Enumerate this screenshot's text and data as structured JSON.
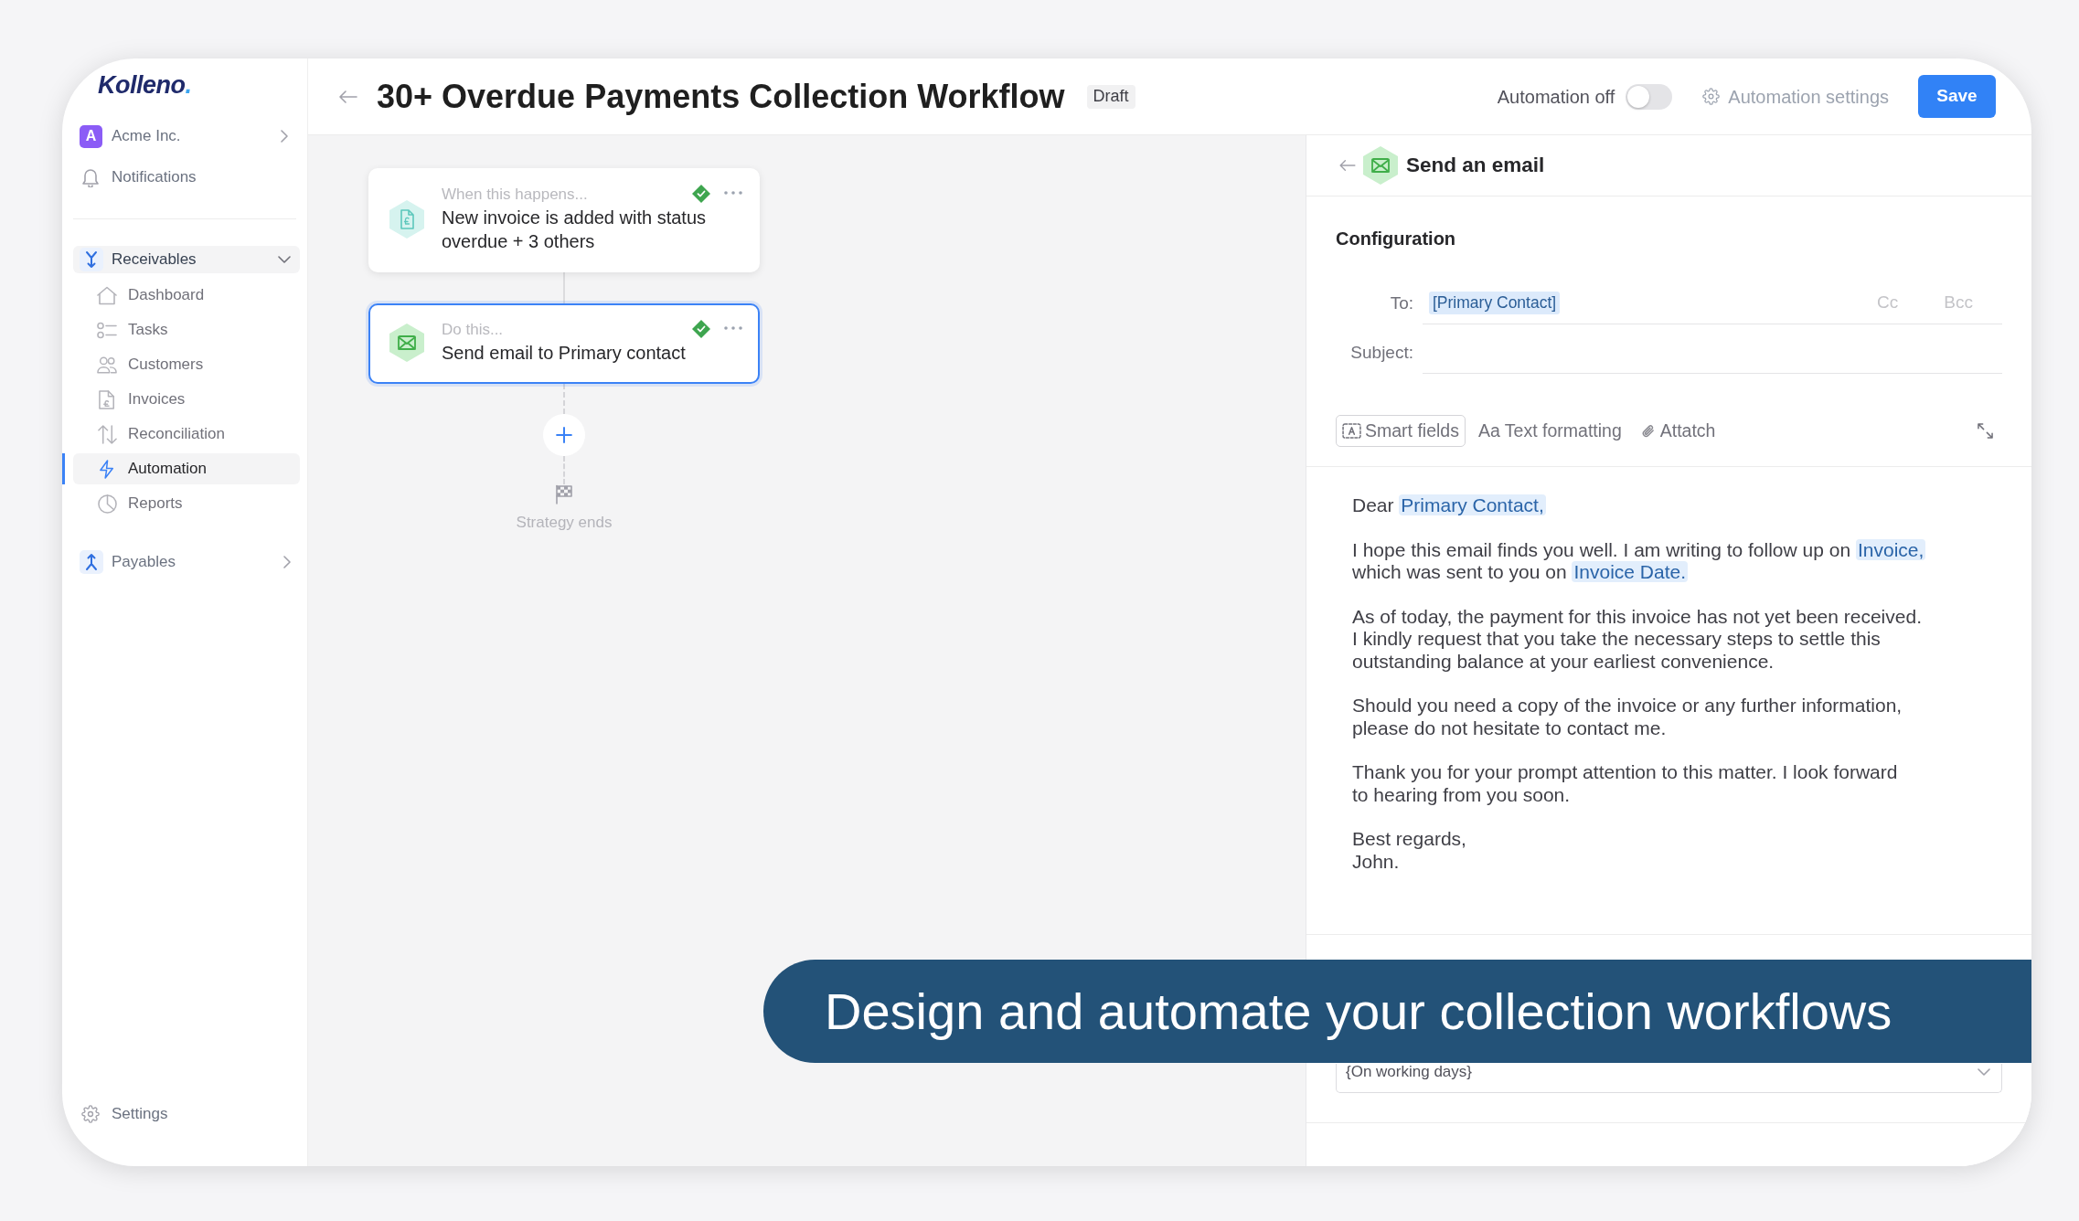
{
  "sidebar": {
    "logo": "Kolleno.",
    "workspace": {
      "initial": "A",
      "name": "Acme Inc."
    },
    "notifications": "Notifications",
    "sections": [
      {
        "label": "Receivables",
        "expanded": true,
        "children": [
          {
            "label": "Dashboard",
            "selected": false
          },
          {
            "label": "Tasks",
            "selected": false
          },
          {
            "label": "Customers",
            "selected": false
          },
          {
            "label": "Invoices",
            "selected": false
          },
          {
            "label": "Reconciliation",
            "selected": false
          },
          {
            "label": "Automation",
            "selected": true
          },
          {
            "label": "Reports",
            "selected": false
          }
        ]
      },
      {
        "label": "Payables",
        "expanded": false
      }
    ],
    "settings": "Settings"
  },
  "header": {
    "title": "30+ Overdue Payments Collection Workflow",
    "status": "Draft",
    "automation_label": "Automation off",
    "automation_on": false,
    "settings_link": "Automation settings",
    "save_button": "Save"
  },
  "workflow": {
    "steps": [
      {
        "kind": "trigger",
        "caption": "When this happens...",
        "text": "New invoice is added with status\noverdue + 3 others",
        "selected": false,
        "complete": true
      },
      {
        "kind": "action",
        "caption": "Do this...",
        "text": "Send email to Primary contact",
        "selected": true,
        "complete": true
      }
    ],
    "end_label": "Strategy ends"
  },
  "panel": {
    "title": "Send an email",
    "section_title": "Configuration",
    "to_label": "To:",
    "recipients": [
      "[Primary Contact]"
    ],
    "cc": "Cc",
    "bcc": "Bcc",
    "subject_label": "Subject:",
    "toolbar": [
      {
        "kind": "smart",
        "label": "Smart fields"
      },
      {
        "kind": "format",
        "label": "Aa Text formatting"
      },
      {
        "kind": "attach",
        "label": "Attatch"
      }
    ],
    "body": [
      [
        {
          "kind": "text",
          "text": "Dear "
        },
        {
          "kind": "field",
          "text": "Primary Contact,"
        }
      ],
      [
        {
          "kind": "text",
          "text": "I hope this email finds you well. I am writing to follow up on "
        },
        {
          "kind": "field",
          "text": "Invoice,"
        },
        {
          "kind": "text",
          "text": "\nwhich was sent to you on "
        },
        {
          "kind": "field",
          "text": "Invoice Date."
        }
      ],
      [
        {
          "kind": "text",
          "text": "As of today, the payment for this invoice has not yet been received.\nI kindly request that you take the necessary steps to settle this\noutstanding balance at your earliest convenience."
        }
      ],
      [
        {
          "kind": "text",
          "text": "Should you need a copy of the invoice or any further information,\nplease do not hesitate to contact me."
        }
      ],
      [
        {
          "kind": "text",
          "text": "Thank you for your prompt attention to this matter. I look forward\nto hearing from you soon."
        }
      ],
      [
        {
          "kind": "text",
          "text": "Best regards,\nJohn."
        }
      ]
    ],
    "schedule_select": {
      "value": "{On working days}"
    }
  },
  "caption": "Design and automate your collection workflows"
}
